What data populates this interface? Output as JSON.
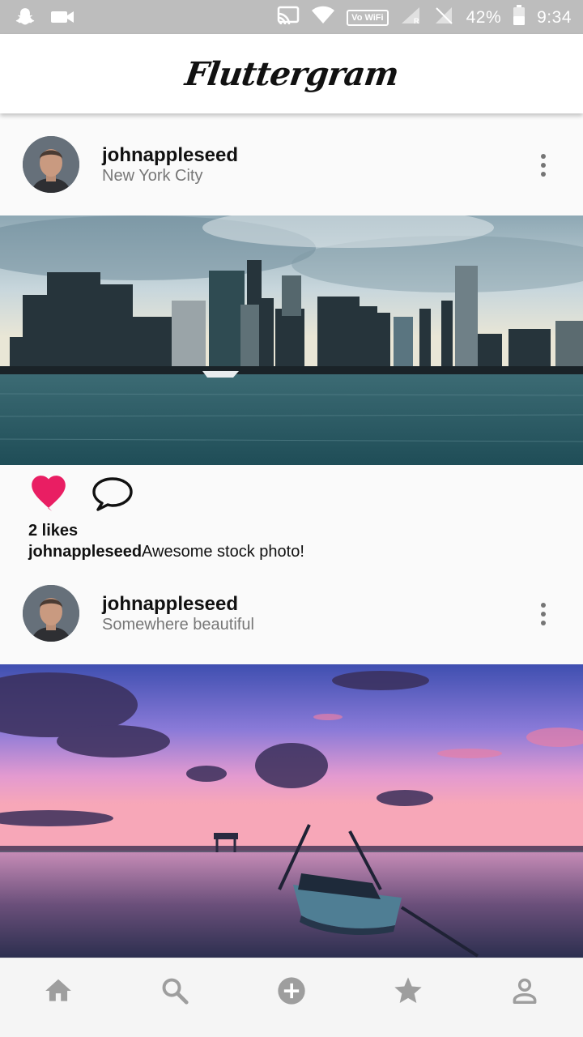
{
  "status_bar": {
    "volte": "Vo WiFi",
    "battery_percent": "42%",
    "time": "9:34"
  },
  "app_bar": {
    "title": "Fluttergram"
  },
  "posts": [
    {
      "username": "johnappleseed",
      "location": "New York City",
      "likes": "2 likes",
      "caption_user": "johnappleseed",
      "caption_text": "Awesome stock photo!",
      "liked": true,
      "heart_color": "#e91e63"
    },
    {
      "username": "johnappleseed",
      "location": "Somewhere beautiful"
    }
  ],
  "bottom_nav": {
    "items": [
      "home-icon",
      "search-icon",
      "add-circle-icon",
      "star-icon",
      "person-icon"
    ],
    "icon_color": "#9e9e9e"
  }
}
